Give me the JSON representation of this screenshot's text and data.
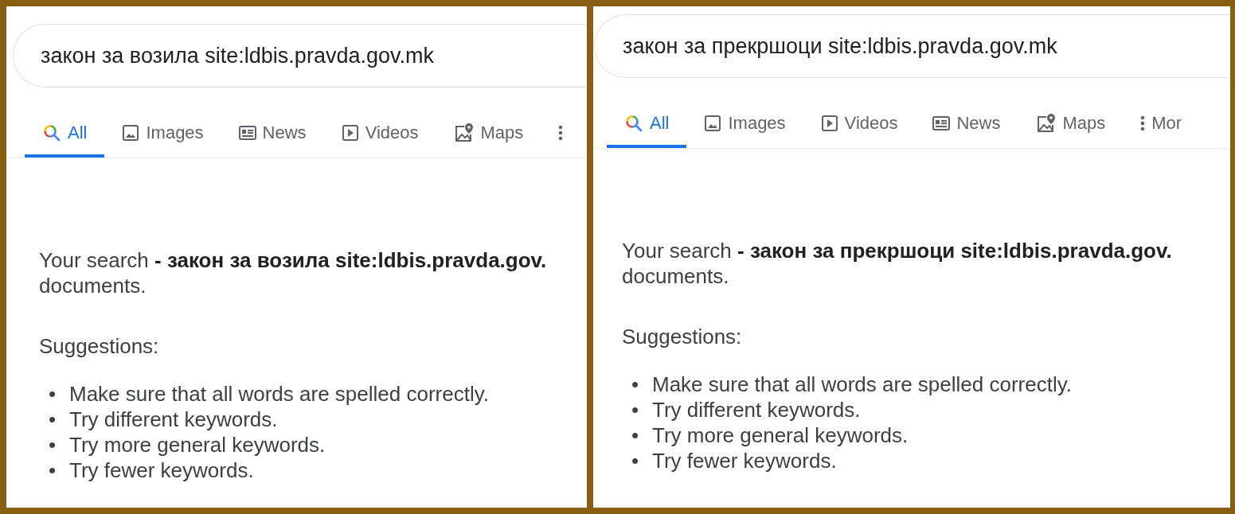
{
  "panels": [
    {
      "query": "закон за возила site:ldbis.pravda.gov.mk",
      "tabs": [
        {
          "kind": "all",
          "label": "All",
          "selected": true
        },
        {
          "kind": "images",
          "label": "Images",
          "selected": false
        },
        {
          "kind": "news",
          "label": "News",
          "selected": false
        },
        {
          "kind": "videos",
          "label": "Videos",
          "selected": false
        },
        {
          "kind": "maps",
          "label": "Maps",
          "selected": false
        },
        {
          "kind": "more",
          "selected": false
        }
      ],
      "message": "Your search **- закон за возила site:ldbis.pravda.gov.**",
      "message_end": "documents.",
      "suggestions_title": "Suggestions:",
      "suggestions": [
        {
          "bullet": "•",
          "text": "Make sure that all words are spelled correctly."
        },
        {
          "bullet": "•",
          "text": "Try different keywords."
        },
        {
          "bullet": "•",
          "text": "Try more general keywords."
        },
        {
          "bullet": "•",
          "text": "Try fewer keywords."
        }
      ]
    },
    {
      "query": "закон за прекршоци site:ldbis.pravda.gov.mk",
      "tabs": [
        {
          "kind": "all",
          "label": "All",
          "selected": true
        },
        {
          "kind": "images",
          "label": "Images",
          "selected": false
        },
        {
          "kind": "videos",
          "label": "Videos",
          "selected": false
        },
        {
          "kind": "news",
          "label": "News",
          "selected": false
        },
        {
          "kind": "maps",
          "label": "Maps",
          "selected": false
        },
        {
          "kind": "more",
          "label": "Mor",
          "selected": false
        }
      ],
      "message": "Your search **- закон за прекршоци site:ldbis.pravda.gov.**",
      "message_end": "documents.",
      "suggestions_title": "Suggestions:",
      "suggestions": [
        {
          "bullet": "•",
          "text": "Make sure that all words are spelled correctly."
        },
        {
          "bullet": "•",
          "text": "Try different keywords."
        },
        {
          "bullet": "•",
          "text": "Try more general keywords."
        },
        {
          "bullet": "•",
          "text": "Try fewer keywords."
        }
      ]
    }
  ]
}
